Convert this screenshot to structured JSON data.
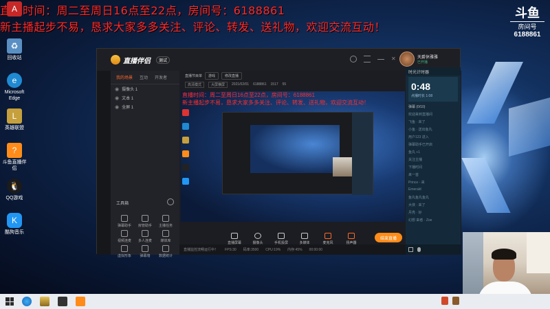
{
  "overlay": {
    "line1": "直播时间：周二至周日16点至22点，房间号：6188861",
    "line2": "新主播起步不易，恳求大家多多关注、评论、转发、送礼物，欢迎交流互动！"
  },
  "douyu": {
    "logo": "斗鱼",
    "room_label": "房间号",
    "room_number": "6188861"
  },
  "desktop_icons": [
    {
      "label": "Acrobat"
    },
    {
      "label": "回收站"
    },
    {
      "label": "Microsoft Edge"
    },
    {
      "label": "英雄联盟"
    },
    {
      "label": "斗鱼直播伴侣"
    },
    {
      "label": "QQ游戏"
    },
    {
      "label": "酷狗音乐"
    }
  ],
  "app": {
    "name": "直播伴侣",
    "beta": "测试",
    "user_name": "天爵休雅雅",
    "user_status": "已开播",
    "left_tabs": [
      "我的场景",
      "互动",
      "开发者"
    ],
    "scenes": [
      "摄像头 1",
      "文本 1",
      "全屏 1"
    ],
    "toolbox_title": "工具箱",
    "tools": [
      "弹幕助手",
      "房管助手",
      "主播任务",
      "视频连麦",
      "多人连麦",
      "媒体库",
      "虚拟形象",
      "弹幕墙",
      "数据统计"
    ],
    "center_top": [
      "直播节目单",
      "游戏",
      "修改直播"
    ],
    "center_sub": [
      "高清模式",
      "大屏横屏",
      "2021/02/01",
      "6188861",
      "1517",
      "55"
    ],
    "preview_line1": "直播时间：周二至周日16点至22点，房间号：6188861",
    "preview_line2": "新主播起步不易，恳求大家多多关注、评论、转发、送礼物，欢迎交流互动！",
    "controls": [
      "直播屏幕",
      "摄像头",
      "手机投屏",
      "多媒体",
      "麦克风",
      "扬声器"
    ],
    "live_button": "结束直播",
    "status": [
      "直播监控流畅运行中！",
      "FPS:30",
      "码率:3500",
      "CPU:19%",
      "内存:45%",
      "00:00:00"
    ],
    "chat_head": "时光计时器",
    "timer": "0:48",
    "timer_sub": "点播时长  1:08",
    "chat_tabs": "弹幕 (0/10)",
    "chat_lines": [
      "欢迎来到直播间",
      "飞鱼 · 来了",
      "小鱼 · 送出鱼丸",
      "用户123 进入",
      "弹幕助手已开启",
      "鱼丸 +1",
      "关注主播",
      "下播时间",
      "来一首",
      "Prince - 来",
      "Emerald",
      "鱼丸鱼丸鱼丸",
      "大侠 · 来了",
      "月亮 · 好",
      "幻想 来者 · Zoe"
    ]
  },
  "taskbar": {
    "time": ""
  }
}
